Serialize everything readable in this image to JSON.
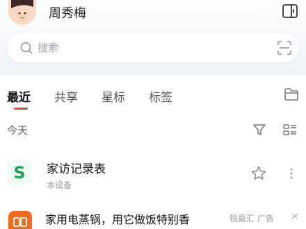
{
  "header": {
    "username": "周秀梅"
  },
  "search": {
    "placeholder": "搜索"
  },
  "tabs": [
    {
      "label": "最近",
      "active": true
    },
    {
      "label": "共享",
      "active": false
    },
    {
      "label": "星标",
      "active": false
    },
    {
      "label": "标签",
      "active": false
    }
  ],
  "section": {
    "label": "今天"
  },
  "files": [
    {
      "title": "家访记录表",
      "subtitle": "本设备",
      "icon": "sheet-file-icon",
      "icon_letter": "S",
      "icon_color": "#1f9d5c"
    }
  ],
  "ad": {
    "title": "家用电蒸锅，用它做饭特别香",
    "source": "锐嘉汇 广告",
    "close": "×",
    "icon": "app-icon",
    "icon_color": "#f26a1b"
  },
  "colors": {
    "accent": "#e0472b",
    "background_top": "#eef2f8"
  }
}
